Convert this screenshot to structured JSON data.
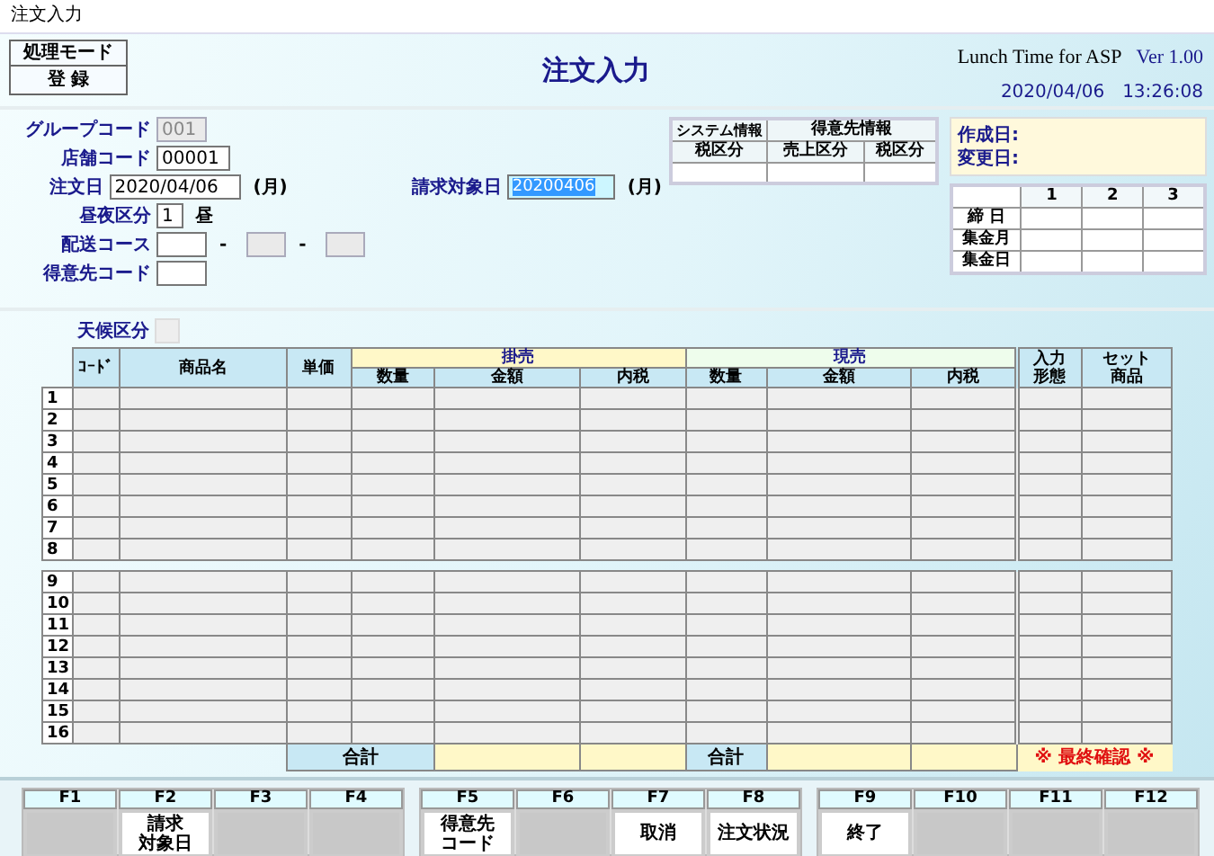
{
  "window": {
    "title": "注文入力"
  },
  "mode": {
    "label": "処理モード",
    "value": "登 録"
  },
  "title": "注文入力",
  "app": {
    "name": "Lunch Time for ASP",
    "version": "Ver 1.00",
    "datetime": "2020/04/06　13:26:08"
  },
  "fields": [
    {
      "label": "グループコード",
      "inputs": [
        {
          "value": "001",
          "disabled": true
        }
      ]
    },
    {
      "label": "店舗コード",
      "inputs": [
        {
          "value": "00001",
          "disabled": false
        }
      ]
    },
    {
      "label": "注文日",
      "inputs": [
        {
          "value": "2020/04/06",
          "disabled": false
        }
      ],
      "suffix": "(月)",
      "aside": {
        "label": "請求対象日",
        "value": "20200406",
        "selected": true,
        "suffix": "(月)"
      }
    },
    {
      "label": "昼夜区分",
      "inputs": [
        {
          "value": "1",
          "disabled": false
        }
      ],
      "suffix": "昼"
    },
    {
      "label": "配送コース",
      "inputs": [
        {
          "disabled": false
        },
        {
          "prefix": "-",
          "disabled": true
        },
        {
          "prefix": "-",
          "disabled": true
        }
      ]
    },
    {
      "label": "得意先コード",
      "inputs": [
        {
          "disabled": false
        }
      ]
    }
  ],
  "info_table": {
    "groups": [
      "システム情報",
      "得意先情報"
    ],
    "columns": [
      "税区分",
      "売上区分",
      "税区分"
    ]
  },
  "dates": [
    "作成日:",
    "変更日:"
  ],
  "closing_table": {
    "columns": [
      "1",
      "2",
      "3"
    ],
    "rows": [
      "締 日",
      "集金月",
      "集金日"
    ]
  },
  "weather": {
    "label": "天候区分"
  },
  "order_table": {
    "columns": [
      "ｺｰﾄﾞ",
      "商品名",
      "単価"
    ],
    "groups": [
      {
        "label": "掛売",
        "color": "#fff8c8",
        "columns": [
          "数量",
          "金額",
          "内税"
        ]
      },
      {
        "label": "現売",
        "color": "#eefdec",
        "columns": [
          "数量",
          "金額",
          "内税"
        ]
      }
    ],
    "extra_columns": [
      "入力形態",
      "セット商品"
    ],
    "row_groups": [
      {
        "numbers": [
          "1",
          "2",
          "3",
          "4",
          "5",
          "6",
          "7",
          "8"
        ]
      },
      {
        "numbers": [
          "9",
          "10",
          "11",
          "12",
          "13",
          "14",
          "15",
          "16"
        ]
      }
    ],
    "totals": [
      "合計",
      "合計"
    ],
    "final_confirm": "※ 最終確認 ※"
  },
  "function_keys": [
    [
      {
        "key": "F1",
        "enabled": false
      },
      {
        "key": "F2",
        "label": [
          "請求",
          "対象日"
        ],
        "enabled": true
      },
      {
        "key": "F3",
        "enabled": false
      },
      {
        "key": "F4",
        "enabled": false
      }
    ],
    [
      {
        "key": "F5",
        "label": [
          "得意先",
          "コード"
        ],
        "enabled": true
      },
      {
        "key": "F6",
        "enabled": false
      },
      {
        "key": "F7",
        "label": [
          "取消"
        ],
        "enabled": true
      },
      {
        "key": "F8",
        "label": [
          "注文状況"
        ],
        "enabled": true
      }
    ],
    [
      {
        "key": "F9",
        "label": [
          "終了"
        ],
        "enabled": true
      },
      {
        "key": "F10",
        "enabled": false
      },
      {
        "key": "F11",
        "enabled": false
      },
      {
        "key": "F12",
        "enabled": false
      }
    ]
  ]
}
